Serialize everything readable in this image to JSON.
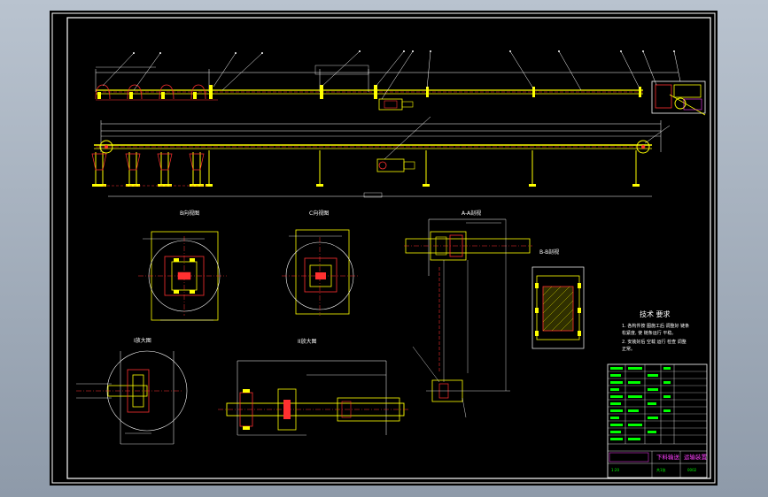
{
  "colors": {
    "background": "#000000",
    "frame": "#ffffff",
    "cyan": "#00ffff",
    "yellow": "#ffff00",
    "red": "#ff3030",
    "magenta": "#ff40ff",
    "green": "#00ff00",
    "window": "#9aa6b4"
  },
  "section_labels": {
    "a": "B向视图",
    "b": "C向视图",
    "c": "A-A剖视",
    "d": "I放大图",
    "e": "II放大图",
    "f": "B-B剖视"
  },
  "notes": {
    "title": "技术 要求",
    "line1": "1. 各构件按 图施工后 调整好 链条",
    "line2": "   松紧度, 使 链条运行 平稳。",
    "line3": "2. 安装好后 空载 运行 检查 调整",
    "line4": "   正常。"
  },
  "title_block": {
    "drawing_title": "下料输送",
    "part_name": "运输装置",
    "drawing_no": "0002",
    "scale": "1:20",
    "sheet": "共1张"
  }
}
